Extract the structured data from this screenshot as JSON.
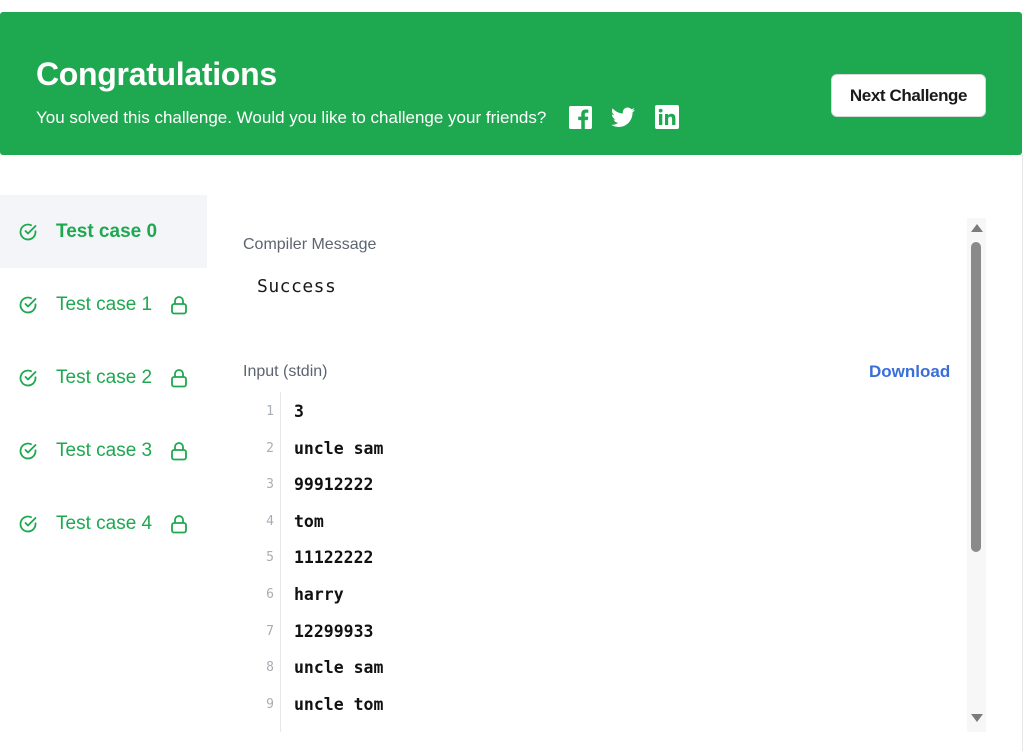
{
  "banner": {
    "title": "Congratulations",
    "subtitle": "You solved this challenge. Would you like to challenge your friends?",
    "social_icons": [
      "facebook-icon",
      "twitter-icon",
      "linkedin-icon"
    ],
    "next_button": "Next Challenge",
    "color": "#1ea84f"
  },
  "test_cases": [
    {
      "label": "Test case 0",
      "locked": false,
      "active": true
    },
    {
      "label": "Test case 1",
      "locked": true,
      "active": false
    },
    {
      "label": "Test case 2",
      "locked": true,
      "active": false
    },
    {
      "label": "Test case 3",
      "locked": true,
      "active": false
    },
    {
      "label": "Test case 4",
      "locked": true,
      "active": false
    }
  ],
  "compiler": {
    "label": "Compiler Message",
    "message": "Success"
  },
  "input": {
    "label": "Input (stdin)",
    "download": "Download",
    "lines": [
      {
        "n": "1",
        "text": "3"
      },
      {
        "n": "2",
        "text": "uncle sam"
      },
      {
        "n": "3",
        "text": "99912222"
      },
      {
        "n": "4",
        "text": "tom"
      },
      {
        "n": "5",
        "text": "11122222"
      },
      {
        "n": "6",
        "text": "harry"
      },
      {
        "n": "7",
        "text": "12299933"
      },
      {
        "n": "8",
        "text": "uncle sam"
      },
      {
        "n": "9",
        "text": "uncle tom"
      }
    ]
  },
  "colors": {
    "accent_green": "#1ea84f",
    "link_blue": "#3a6fd8"
  }
}
